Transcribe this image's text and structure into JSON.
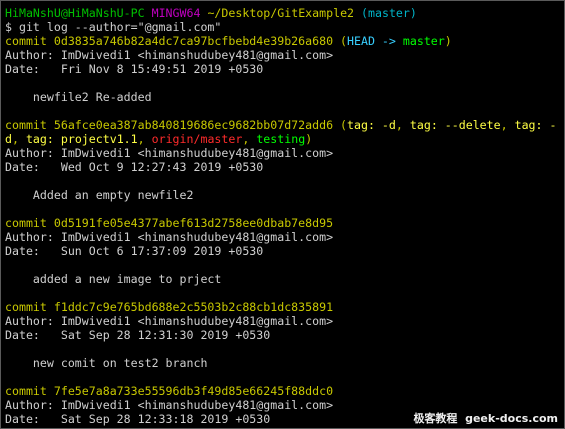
{
  "prompt": {
    "user": "HiMaNshU@HiMaNshU-PC",
    "system": "MINGW64",
    "path": "~/Desktop/GitExample2",
    "branch": "(master)"
  },
  "command": "$ git log --author=\"@gmail.com\"",
  "commits": [
    {
      "hash_line": "commit 0d3835a746b82a4dc7ca97bcfbebd4e39b26a680",
      "author": "Author: ImDwivedi1 <himanshudubey481@gmail.com>",
      "date": "Date:   Fri Nov 8 15:49:51 2019 +0530",
      "message": "    newfile2 Re-added"
    },
    {
      "hash_line": "commit 56afce0ea387ab840819686ec9682bb07d72add6",
      "author": "Author: ImDwivedi1 <himanshudubey481@gmail.com>",
      "date": "Date:   Wed Oct 9 12:27:43 2019 +0530",
      "message": "    Added an empty newfile2"
    },
    {
      "hash_line": "commit 0d5191fe05e4377abef613d2758ee0dbab7e8d95",
      "author": "Author: ImDwivedi1 <himanshudubey481@gmail.com>",
      "date": "Date:   Sun Oct 6 17:37:09 2019 +0530",
      "message": "    added a new image to prject"
    },
    {
      "hash_line": "commit f1ddc7c9e765bd688e2c5503b2c88cb1dc835891",
      "author": "Author: ImDwivedi1 <himanshudubey481@gmail.com>",
      "date": "Date:   Sat Sep 28 12:31:30 2019 +0530",
      "message": "    new comit on test2 branch"
    },
    {
      "hash_line": "commit 7fe5e7a8a733e55596db3f49d85e66245f88ddc0",
      "author": "Author: ImDwivedi1 <himanshudubey481@gmail.com>",
      "date": "Date:   Sat Sep 28 12:33:18 2019 +0530"
    }
  ],
  "refs": {
    "head": {
      "open": "(",
      "head": "HEAD -> ",
      "branch": "master",
      "close": ")"
    },
    "tags": {
      "open": "(",
      "tag1": "tag: -d",
      "sep1": ", ",
      "tag2": "tag: --delete",
      "sep2": ", ",
      "tag3_start": "tag: -",
      "tag3_end": "d",
      "sep3": ", ",
      "tag4": "tag: projectv1.1",
      "sep4": ", ",
      "remote": "origin/master",
      "sep5": ", ",
      "branch": "testing",
      "close": ")"
    }
  },
  "watermark": "极客教程  geek-docs.com",
  "colors": {
    "prompt_user": "#00c000",
    "prompt_system": "#c000c0",
    "prompt_path": "#c8c800",
    "prompt_branch": "#00b4c8",
    "commit_hash": "#c8c800",
    "head_ref": "#38d0ff",
    "local_branch": "#00ff00",
    "remote_branch": "#ff2b2b",
    "tag": "#ffff44",
    "text": "#c0c0c0",
    "background": "#000000"
  }
}
